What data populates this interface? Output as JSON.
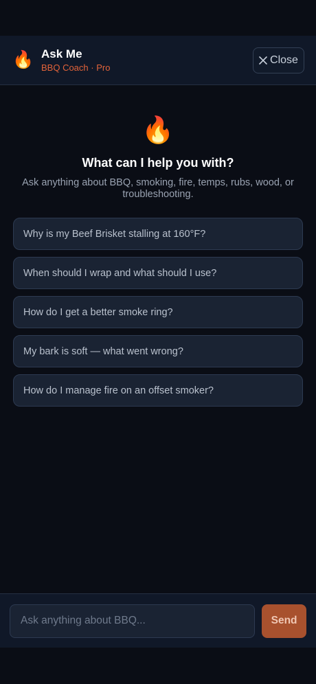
{
  "header": {
    "icon": "fire-emoji",
    "title": "Ask Me",
    "subtitle": "BBQ Coach · Pro",
    "close_label": "Close"
  },
  "hero": {
    "icon": "fire-emoji",
    "headline": "What can I help you with?",
    "description": "Ask anything about BBQ, smoking, fire, temps, rubs, wood, or troubleshooting."
  },
  "suggestions": [
    "Why is my Beef Brisket stalling at 160°F?",
    "When should I wrap and what should I use?",
    "How do I get a better smoke ring?",
    "My bark is soft — what went wrong?",
    "How do I manage fire on an offset smoker?"
  ],
  "composer": {
    "placeholder": "Ask anything about BBQ...",
    "send_label": "Send"
  },
  "colors": {
    "accent": "#e2633a",
    "send_button": "#a8512e",
    "background": "#0a0d15"
  }
}
